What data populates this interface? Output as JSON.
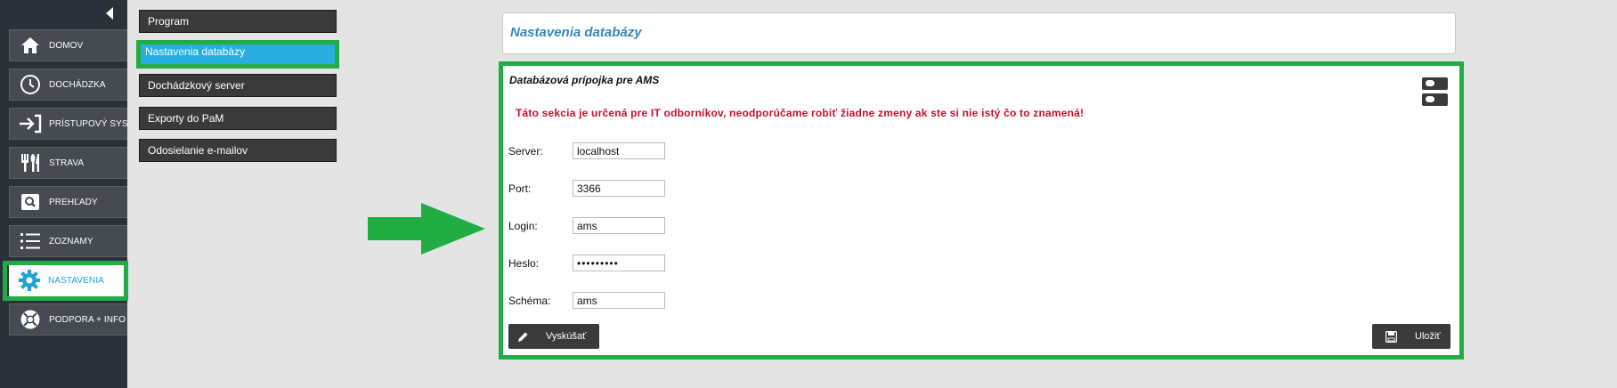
{
  "sidebar": {
    "items": [
      {
        "label": "DOMOV",
        "icon": "home-icon"
      },
      {
        "label": "DOCHÁDZKA",
        "icon": "clock-icon"
      },
      {
        "label": "PRÍSTUPOVÝ SYS.",
        "icon": "login-icon"
      },
      {
        "label": "STRAVA",
        "icon": "cutlery-icon"
      },
      {
        "label": "PREHĽADY",
        "icon": "search-icon"
      },
      {
        "label": "ZOZNAMY",
        "icon": "list-icon"
      },
      {
        "label": "NASTAVENIA",
        "icon": "gear-icon",
        "active": true
      },
      {
        "label": "PODPORA + INFO",
        "icon": "lifebuoy-icon"
      }
    ]
  },
  "submenu": {
    "items": [
      {
        "label": "Program"
      },
      {
        "label": "Nastavenia databázy",
        "active": true
      },
      {
        "label": "Dochádzkový server"
      },
      {
        "label": "Exporty do PaM"
      },
      {
        "label": "Odosielanie e-mailov"
      }
    ]
  },
  "header": {
    "title": "Nastavenia databázy"
  },
  "panel": {
    "title": "Databázová prípojka pre AMS",
    "warning": "Táto sekcia je určená pre IT odborníkov, neodporúčame robiť žiadne zmeny ak ste si nie istý čo to znamená!",
    "fields": [
      {
        "label": "Server:",
        "value": "localhost",
        "type": "text"
      },
      {
        "label": "Port:",
        "value": "3366",
        "type": "text"
      },
      {
        "label": "Login:",
        "value": "ams",
        "type": "text"
      },
      {
        "label": "Heslo:",
        "value": "•••••••••",
        "type": "password"
      },
      {
        "label": "Schéma:",
        "value": "ams",
        "type": "text"
      }
    ],
    "test_button": {
      "label": "Vyskúšať",
      "icon": "pencil-icon"
    },
    "save_button": {
      "label": "Uložiť",
      "icon": "save-icon"
    }
  },
  "colors": {
    "sidebar_bg": "#2b3138",
    "accent_blue": "#29aee1",
    "highlight_green": "#22ad44",
    "warning_red": "#c8102e",
    "title_blue": "#3689bc"
  }
}
